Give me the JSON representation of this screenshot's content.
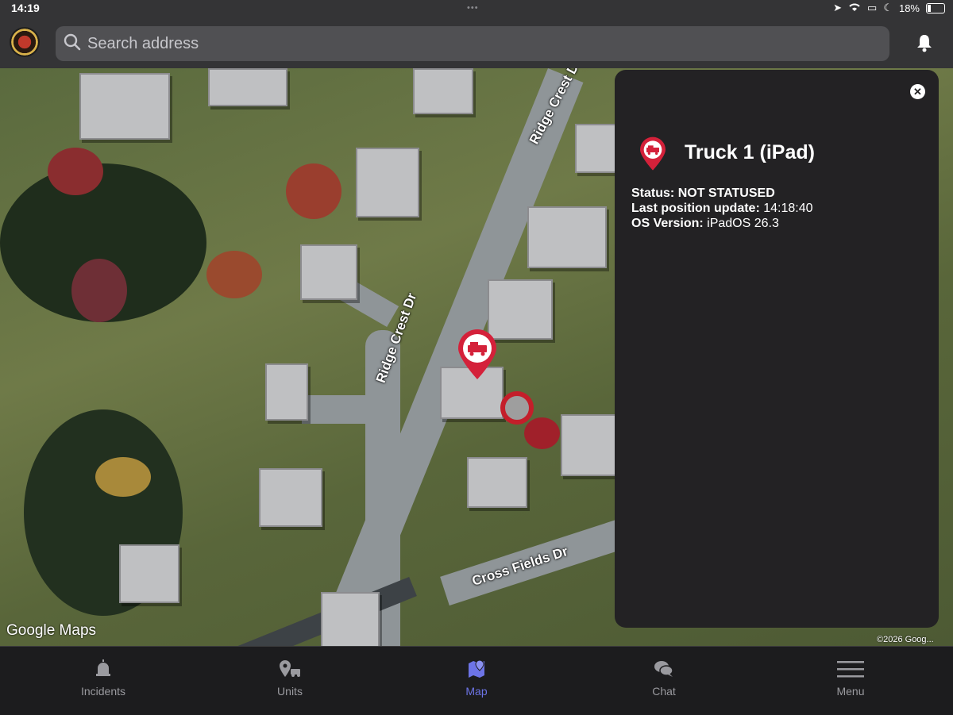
{
  "status_bar": {
    "time": "14:19",
    "battery": "18%"
  },
  "header": {
    "search_placeholder": "Search address"
  },
  "map": {
    "roads": [
      "Ridge Crest Dr",
      "Ridge Crest Dr",
      "Cross Fields Dr"
    ],
    "attribution": "Google Maps",
    "copyright": "©2026 Goog..."
  },
  "panel": {
    "title": "Truck 1 (iPad)",
    "status_label": "Status:",
    "status_value": "NOT STATUSED",
    "position_label": "Last position update:",
    "position_value": "14:18:40",
    "os_label": "OS Version:",
    "os_value": "iPadOS 26.3"
  },
  "tabs": [
    {
      "label": "Incidents",
      "icon": "alarm-bell-icon"
    },
    {
      "label": "Units",
      "icon": "units-location-icon"
    },
    {
      "label": "Map",
      "icon": "map-pin-icon"
    },
    {
      "label": "Chat",
      "icon": "chat-bubbles-icon"
    },
    {
      "label": "Menu",
      "icon": "hamburger-menu-icon"
    }
  ],
  "colors": {
    "accent": "#6d74e6",
    "marker": "#c41e2a",
    "panel": "#232224"
  }
}
